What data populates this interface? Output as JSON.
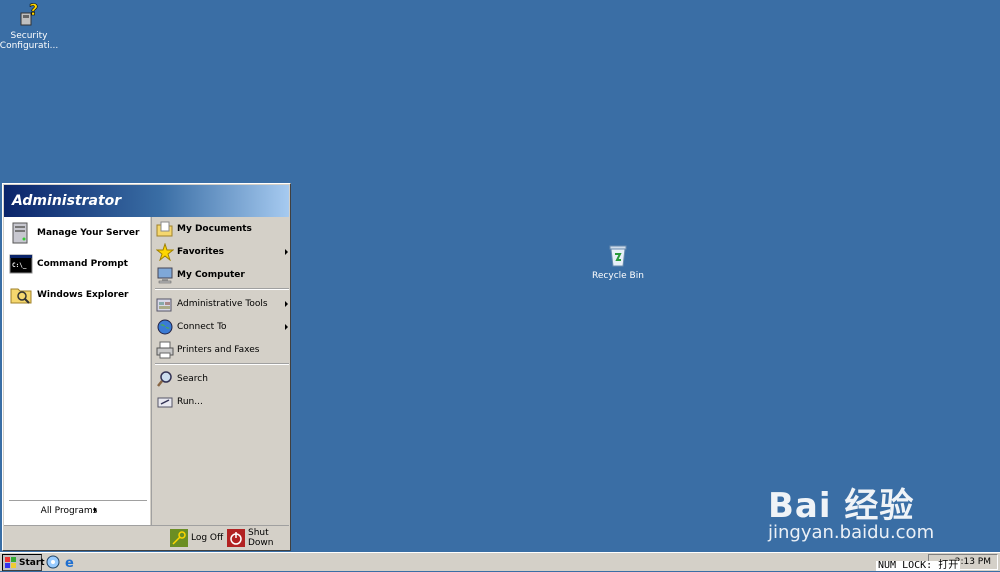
{
  "desktop": {
    "icons": [
      {
        "label": "Security Configurati...",
        "icon": "security-config-icon"
      },
      {
        "label": "Recycle Bin",
        "icon": "recycle-bin-icon"
      }
    ],
    "background": "#3a6ea5"
  },
  "start_menu": {
    "user": "Administrator",
    "left_items": [
      {
        "label": "Manage Your Server",
        "icon": "server-icon"
      },
      {
        "label": "Command Prompt",
        "icon": "cmd-icon"
      },
      {
        "label": "Windows Explorer",
        "icon": "explorer-icon"
      }
    ],
    "all_programs": "All Programs",
    "right_items": [
      {
        "label": "My Documents",
        "icon": "documents-folder-icon"
      },
      {
        "label": "Favorites",
        "icon": "favorites-star-icon"
      },
      {
        "label": "My Computer",
        "icon": "computer-icon"
      },
      {
        "label": "Administrative Tools",
        "icon": "admin-tools-icon"
      },
      {
        "label": "Connect To",
        "icon": "connect-globe-icon"
      },
      {
        "label": "Printers and Faxes",
        "icon": "printer-icon"
      },
      {
        "label": "Search",
        "icon": "search-icon"
      },
      {
        "label": "Run...",
        "icon": "run-icon"
      }
    ],
    "log_off": "Log Off",
    "shut_down": "Shut Down"
  },
  "taskbar": {
    "start_label": "Start",
    "clock": "2:13 PM",
    "numlock": "NUM LOCK: 打开"
  },
  "watermark": {
    "logo": "Bai 经验",
    "url": "jingyan.baidu.com"
  }
}
